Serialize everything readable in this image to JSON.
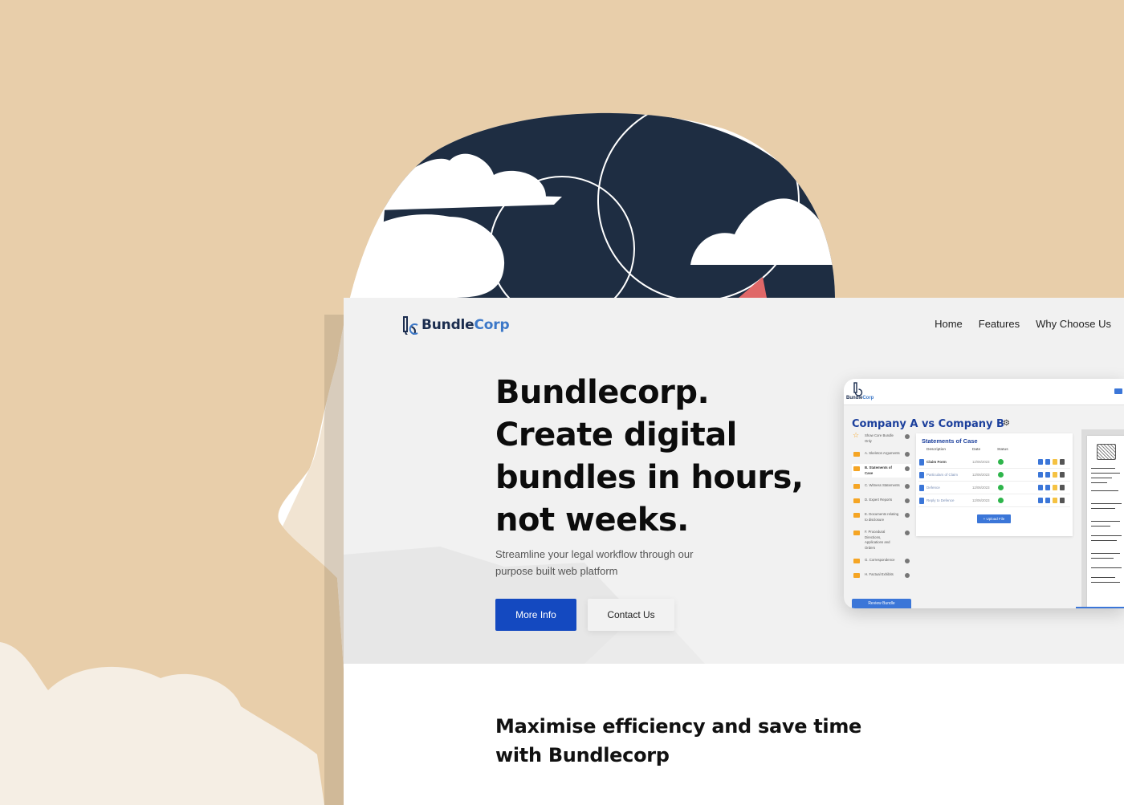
{
  "brand": {
    "name_part1": "Bundle",
    "name_part2": "Corp",
    "accent": "#3c78c8",
    "dark": "#1b2d4f"
  },
  "nav": {
    "items": [
      "Home",
      "Features",
      "Why Choose Us"
    ]
  },
  "hero": {
    "title_line1": "Bundlecorp.",
    "title_line2": "Create digital",
    "title_line3": "bundles in hours,",
    "title_line4": "not weeks.",
    "subtitle_line1": "Streamline your legal workflow through our",
    "subtitle_line2": "purpose built web platform",
    "primary_button": "More Info",
    "secondary_button": "Contact Us",
    "primary_color": "#1449c0"
  },
  "preview": {
    "logo_part1": "Bundle",
    "logo_part2": "Corp",
    "case_title": "Company A vs Company B",
    "sidebar": [
      {
        "label": "Show Core Bundle Only",
        "icon": "star-icon"
      },
      {
        "label": "A. Skeleton Arguments",
        "icon": "folder-icon"
      },
      {
        "label": "B. Statements of Case",
        "icon": "folder-icon"
      },
      {
        "label": "C. Witness Statements",
        "icon": "folder-icon"
      },
      {
        "label": "D. Expert Reports",
        "icon": "folder-icon"
      },
      {
        "label": "E. Documents relating to disclosure",
        "icon": "folder-icon"
      },
      {
        "label": "F. Procedural Directions, Applications and Orders",
        "icon": "folder-icon"
      },
      {
        "label": "G. Correspondence",
        "icon": "folder-icon"
      },
      {
        "label": "H. Factual Exhibits",
        "icon": "folder-icon"
      }
    ],
    "review_button": "Review Bundle",
    "panel": {
      "title": "Statements of Case",
      "columns": [
        "Description",
        "Date",
        "Status"
      ],
      "rows": [
        {
          "name": "Claim Form",
          "date": "12/06/2023"
        },
        {
          "name": "Particulars of Claim",
          "date": "12/06/2023"
        },
        {
          "name": "Defence",
          "date": "12/06/2023"
        },
        {
          "name": "Reply to Defence",
          "date": "12/06/2023"
        }
      ],
      "upload_button": "+ Upload File"
    }
  },
  "section2": {
    "title_line1": "Maximise efficiency and save time",
    "title_line2": "with Bundlecorp"
  }
}
